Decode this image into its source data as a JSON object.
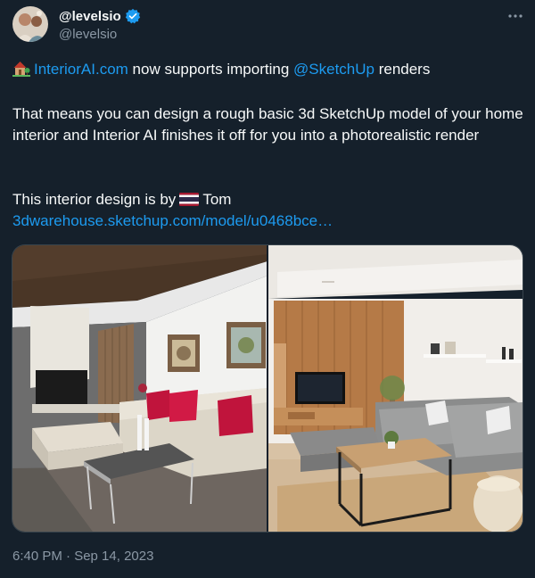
{
  "author": {
    "display_name": "@levelsio",
    "handle": "@levelsio"
  },
  "tweet": {
    "line1": {
      "house_icon": "house-with-garden-emoji",
      "link_site": "InteriorAI.com",
      "text_mid": " now supports importing ",
      "link_mention": "@SketchUp",
      "text_end": " renders"
    },
    "paragraph2": "That means you can design a rough basic 3d SketchUp model of your home interior and Interior AI finishes it off for you into a photorealistic render",
    "paragraph3": {
      "text_start": "This interior design is by",
      "flag_icon": "thailand-flag-emoji",
      "text_end": "Tom"
    },
    "link_url": "3dwarehouse.sketchup.com/model/u0468bce…"
  },
  "media": {
    "images": [
      "sketchup-render",
      "interior-ai-photorealistic-render"
    ]
  },
  "timestamp": "6:40 PM · Sep 14, 2023",
  "colors": {
    "background": "#15202b",
    "text": "#f7f9f9",
    "secondary": "#8b98a5",
    "link": "#1d9bf0",
    "verified": "#1d9bf0"
  }
}
